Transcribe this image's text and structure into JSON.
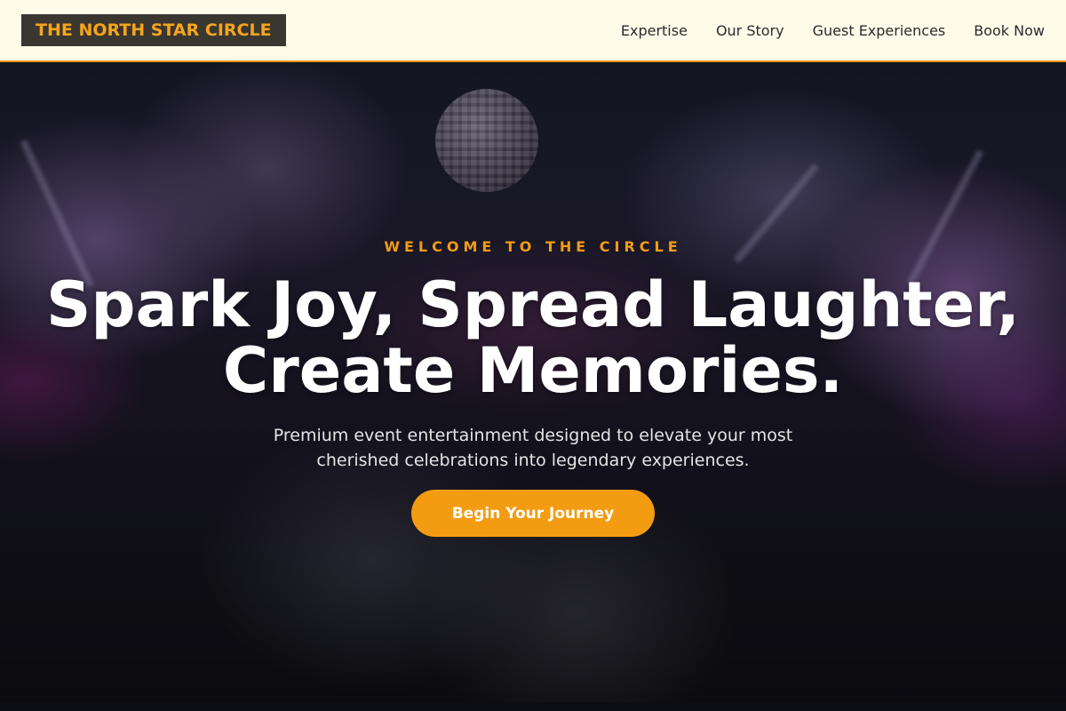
{
  "header": {
    "logo": "THE NORTH STAR CIRCLE",
    "nav": [
      {
        "label": "Expertise"
      },
      {
        "label": "Our Story"
      },
      {
        "label": "Guest Experiences"
      },
      {
        "label": "Book Now"
      }
    ]
  },
  "hero": {
    "eyebrow": "WELCOME TO THE CIRCLE",
    "headline_line1": "Spark Joy, Spread Laughter,",
    "headline_line2": "Create Memories.",
    "subtext_line1": "Premium event entertainment designed to elevate your most",
    "subtext_line2": "cherished celebrations into legendary experiences.",
    "cta_label": "Begin Your Journey"
  },
  "colors": {
    "accent": "#f39c12",
    "header_bg": "#fefbe9",
    "logo_bg": "#3a3630"
  }
}
